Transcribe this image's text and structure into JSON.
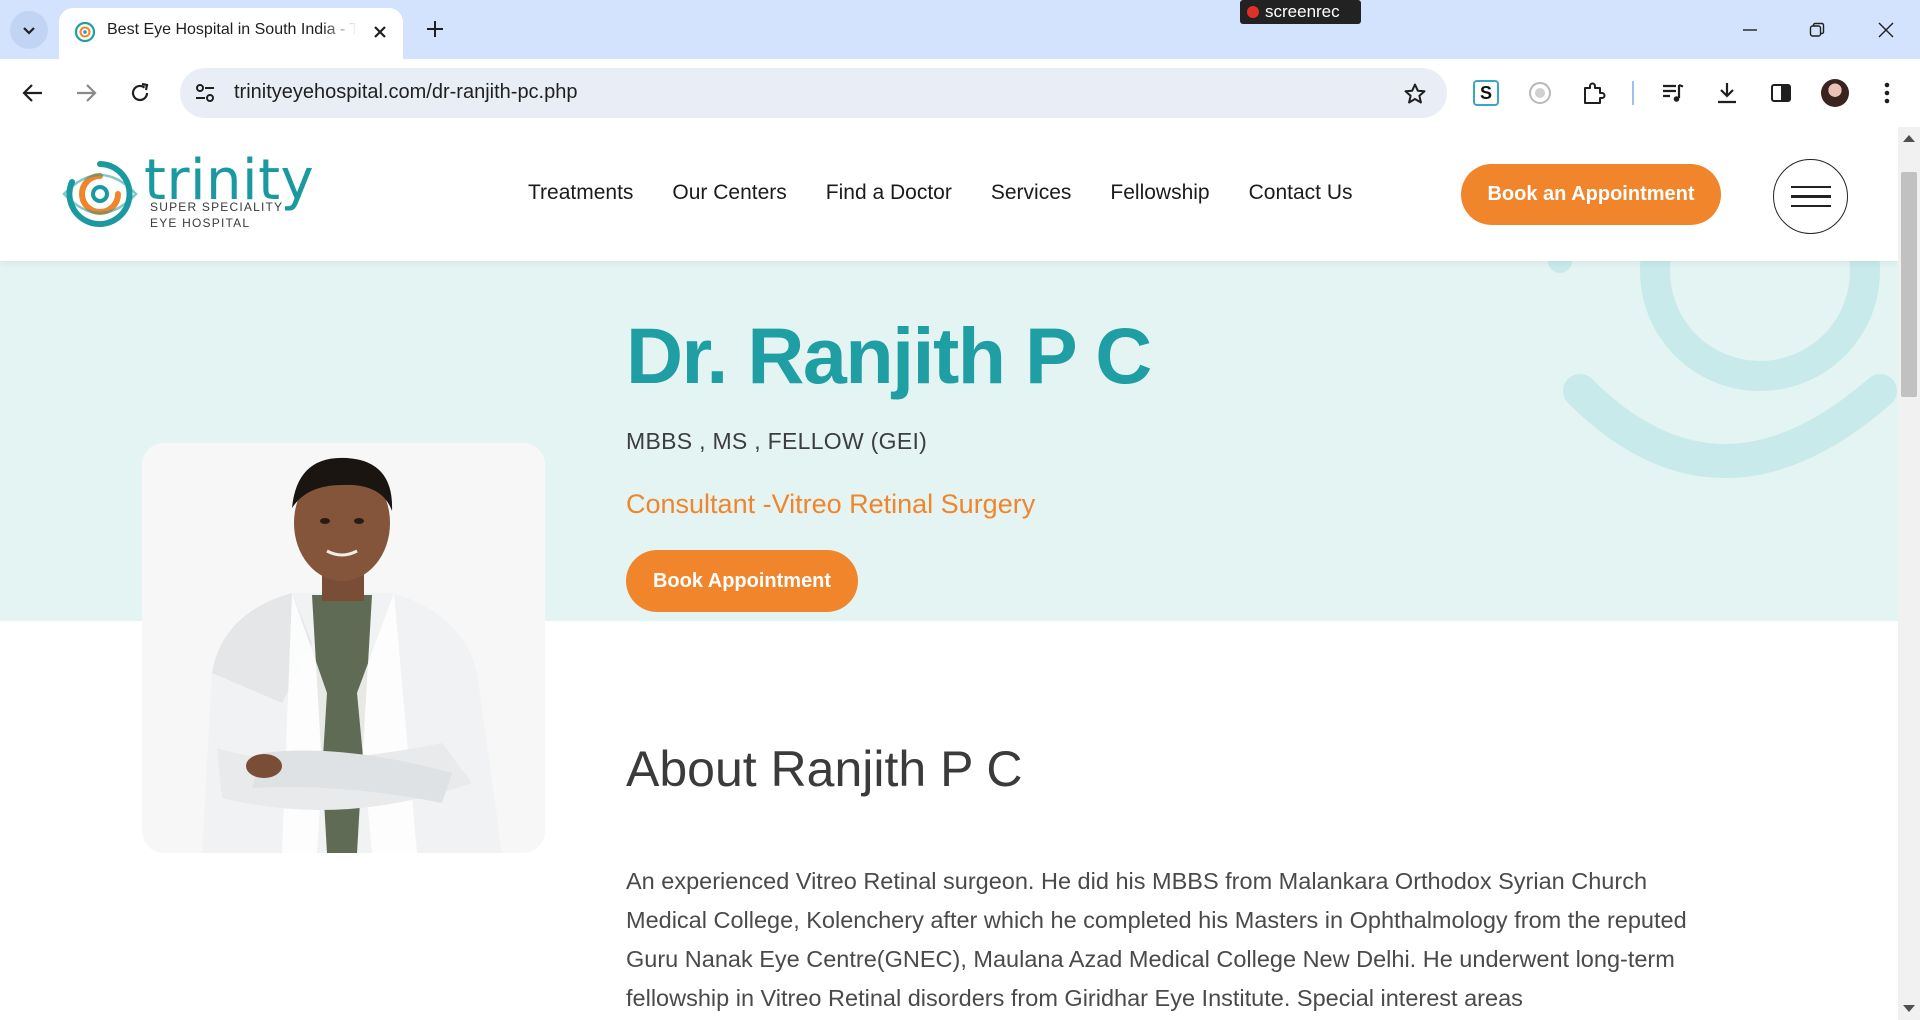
{
  "browser": {
    "tab_title": "Best Eye Hospital in South India - Trinity Eye Hospital",
    "recorder_label": "screenrec",
    "url": "trinityeyehospital.com/dr-ranjith-pc.php"
  },
  "site": {
    "logo": {
      "wordmark": "trinity",
      "line1": "SUPER SPECIALITY",
      "line2": "EYE HOSPITAL"
    },
    "nav": [
      {
        "label": "Treatments"
      },
      {
        "label": "Our Centers"
      },
      {
        "label": "Find a Doctor"
      },
      {
        "label": "Services"
      },
      {
        "label": "Fellowship"
      },
      {
        "label": "Contact Us"
      }
    ],
    "header_cta": "Book an Appointment"
  },
  "doctor": {
    "name": "Dr. Ranjith P C",
    "qualifications": "MBBS , MS , FELLOW (GEI)",
    "role": "Consultant -Vitreo Retinal Surgery",
    "cta": "Book Appointment",
    "about_title": "About Ranjith P C",
    "about_text": "An experienced Vitreo Retinal surgeon. He did his MBBS from Malankara Orthodox Syrian Church Medical College, Kolenchery after which he completed his Masters in Ophthalmology from the reputed Guru Nanak Eye Centre(GNEC), Maulana Azad Medical College New Delhi. He underwent long-term fellowship in Vitreo Retinal disorders from Giridhar Eye Institute. Special interest areas"
  },
  "colors": {
    "brand_teal": "#1f9ea3",
    "brand_orange": "#f1852c",
    "hero_bg": "#e3f4f3"
  }
}
